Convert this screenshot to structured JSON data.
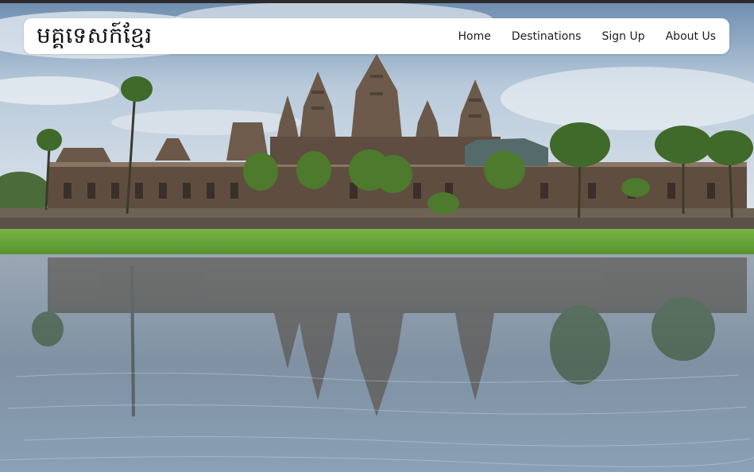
{
  "site": {
    "brand": "មគ្គទេសក៍ខ្មែរ"
  },
  "nav": {
    "items": [
      {
        "label": "Home"
      },
      {
        "label": "Destinations"
      },
      {
        "label": "Sign Up"
      },
      {
        "label": "About Us"
      }
    ]
  },
  "hero": {
    "image_subject": "temple-reflection-photo"
  },
  "colors": {
    "sky": "#cfdbe6",
    "stone": "#6b5a4a",
    "grass": "#6aa83a",
    "water": "#8fa2b4",
    "navbar_bg": "#ffffff",
    "text": "#1d1d1d"
  }
}
